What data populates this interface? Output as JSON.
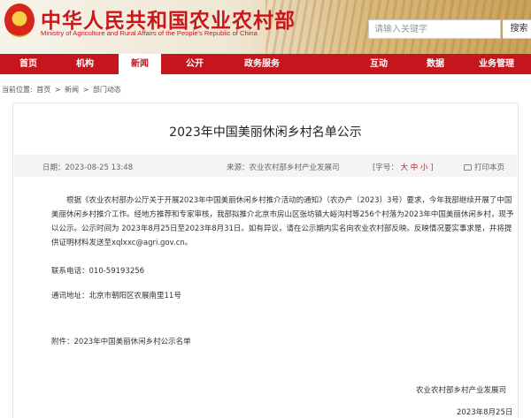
{
  "header": {
    "site_title": "中华人民共和国农业农村部",
    "site_subtitle": "Ministry of Agriculture and Rural Affairs of the People's Republic of China",
    "search_placeholder": "请输入关键字",
    "search_label": "搜索"
  },
  "nav": {
    "items": [
      "首页",
      "机构",
      "新闻",
      "公开",
      "政务服务",
      "互动",
      "数据",
      "业务管理"
    ],
    "active": "新闻"
  },
  "breadcrumb": {
    "label": "当前位置:",
    "items": [
      "首页",
      "新闻",
      "部门动态"
    ],
    "separator": ">"
  },
  "article": {
    "title": "2023年中国美丽休闲乡村名单公示",
    "date": "日期：2023-08-25 13:48",
    "source": "来源：农业农村部乡村产业发展司",
    "font_size_label": "[字号：",
    "font_size_options": [
      "大",
      "中",
      "小"
    ],
    "font_size_end": "]",
    "print_label": "打印本页",
    "paragraph": "根据《农业农村部办公厅关于开展2023年中国美丽休闲乡村推介活动的通知》（农办产〔2023〕3号）要求，今年我部继续开展了中国美丽休闲乡村推介工作。经地方推荐和专家审核，我部拟推介北京市房山区张坊镇大峪沟村等256个村落为2023年中国美丽休闲乡村，现予以公示。公示时间为 2023年8月25日至2023年8月31日。如有异议，请在公示期内实名向农业农村部反映。反映情况要实事求是，并将提供证明材料发送至xqlxxc@agri.gov.cn。",
    "phone": "联系电话：010-59193256",
    "address": "通讯地址：北京市朝阳区农展南里11号",
    "attachment": "附件：2023年中国美丽休闲乡村公示名单",
    "signature_org": "农业农村部乡村产业发展司",
    "signature_date": "2023年8月25日"
  }
}
